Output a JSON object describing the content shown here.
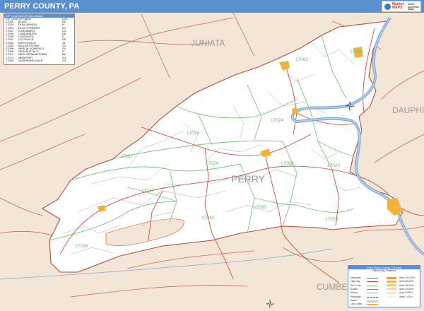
{
  "title": "PERRY COUNTY, PA",
  "logo": {
    "text": "Market MAPS",
    "right_text": "North American Maps"
  },
  "zip_legend": {
    "header": "ZIP Code Index/Post Location",
    "columns": [
      "ZIP Code",
      "ZIP Name",
      "LOC"
    ],
    "rows": [
      [
        "17006",
        "BLAIN",
        "B6"
      ],
      [
        "17020",
        "DUNCANNON",
        "I4"
      ],
      [
        "17024",
        "ELLIOTTSBURG",
        "E4"
      ],
      [
        "17037",
        "ICKESBURG",
        "D4"
      ],
      [
        "17040",
        "LANDISBURG",
        "D6"
      ],
      [
        "17045",
        "LIVERPOOL",
        "I1"
      ],
      [
        "17047",
        "LOYSVILLE",
        "D5"
      ],
      [
        "17053",
        "MARYSVILLE",
        "J5"
      ],
      [
        "17062",
        "MILLERSTOWN",
        "G2"
      ],
      [
        "17068",
        "NEW BLOOMFIELD",
        "G4"
      ],
      [
        "17069",
        "NEW BUFFALO",
        "I2"
      ],
      [
        "17071",
        "NEW GERMANTOWN",
        "B6"
      ],
      [
        "17074",
        "NEWPORT",
        "G3"
      ],
      [
        "17090",
        "SHERMANS DALE",
        "G5"
      ]
    ]
  },
  "map_legend": {
    "header": "2016 Perry County, PA Map",
    "subtitle": "Official Map Features",
    "left_items": [
      "Interstate",
      "Highway",
      "ZIP Code",
      "Roads",
      "Rivers",
      "Railroads",
      "Water",
      "City Limits"
    ],
    "right_items": [
      "Area 100,000+",
      "Area 50,000+",
      "Area 25,000+",
      "Area 10,000+",
      "Area 5,000+",
      "Area 1,000+"
    ]
  },
  "county_label": "PERRY",
  "neighbor_labels": [
    "JUNIATA",
    "DAUPHIN",
    "CUMBER"
  ],
  "zip_labels": [
    "17062",
    "17045",
    "17074",
    "17074",
    "17037",
    "17024",
    "17068",
    "17020",
    "17047",
    "17090",
    "17040",
    "17053",
    "17006"
  ],
  "colors": {
    "title_bar": "#5a8fd0",
    "county_fill": "#ffffff",
    "outside_fill": "#f4e6d6",
    "river": "#7fa7d6",
    "county_border": "#b84a3c",
    "zip_boundary": "#7ac67a",
    "major_road": "#d23c2c",
    "town": "#f5b23a"
  }
}
